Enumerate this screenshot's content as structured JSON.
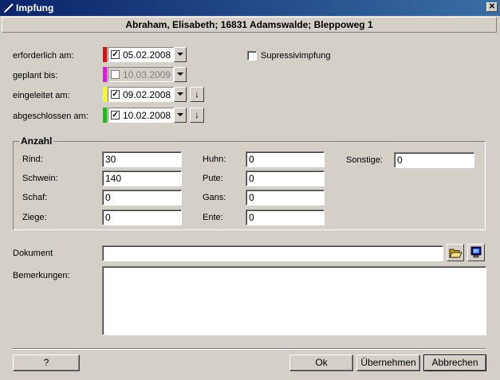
{
  "window": {
    "title": "Impfung",
    "close_symbol": "✕"
  },
  "header": {
    "text": "Abraham, Elisabeth; 16831 Adamswalde; Bleppoweg 1"
  },
  "dates": [
    {
      "label": "erforderlich am:",
      "color": "#ff0000",
      "checked": "✓",
      "value": "05.02.2008",
      "enabled": true
    },
    {
      "label": "geplant bis:",
      "color": "#ff00ff",
      "checked": "",
      "value": "10.03.2009",
      "enabled": false
    },
    {
      "label": "eingeleitet am:",
      "color": "#ffff00",
      "checked": "✓",
      "value": "09.02.2008",
      "enabled": true
    },
    {
      "label": "abgeschlossen am:",
      "color": "#00cc00",
      "checked": "✓",
      "value": "10.02.2008",
      "enabled": true
    }
  ],
  "arrow_symbol": "↓",
  "supressiv": {
    "label": "Supressivimpfung",
    "checked": false
  },
  "anzahl": {
    "title": "Anzahl",
    "left": [
      {
        "label": "Rind:",
        "value": "30"
      },
      {
        "label": "Schwein:",
        "value": "140"
      },
      {
        "label": "Schaf:",
        "value": "0"
      },
      {
        "label": "Ziege:",
        "value": "0"
      }
    ],
    "right": [
      {
        "label": "Huhn:",
        "value": "0"
      },
      {
        "label": "Pute:",
        "value": "0"
      },
      {
        "label": "Gans:",
        "value": "0"
      },
      {
        "label": "Ente:",
        "value": "0"
      }
    ],
    "sonstige": {
      "label": "Sonstige:",
      "value": "0"
    }
  },
  "dokument": {
    "label": "Dokument",
    "value": ""
  },
  "bemerkungen": {
    "label": "Bemerkungen:",
    "value": ""
  },
  "buttons": {
    "help": "?",
    "ok": "Ok",
    "apply": "Übernehmen",
    "cancel": "Abbrechen"
  },
  "icons": {
    "folder": "folder-open-icon",
    "monitor": "monitor-icon"
  }
}
